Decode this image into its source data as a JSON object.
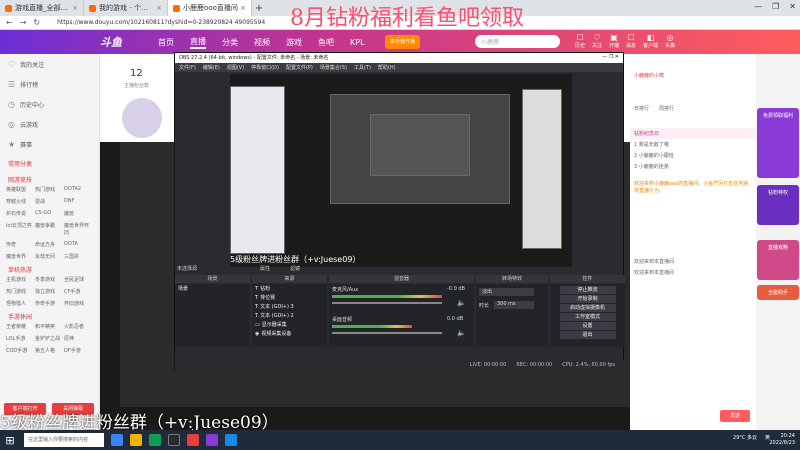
{
  "browser": {
    "tabs": [
      {
        "label": "游戏直播_全部游戏直播_斗鱼直...",
        "active": false
      },
      {
        "label": "我的游戏 - 个人中心 - 斗鱼",
        "active": false
      },
      {
        "label": "小鹿鹿ooo直播间",
        "active": true
      }
    ],
    "new_tab": "+",
    "url": "https://www.douyu.com/102160811?dyshid=0-238920824 49095594",
    "controls": [
      "—",
      "❐",
      "✕"
    ]
  },
  "site": {
    "logo": "斗鱼",
    "nav": [
      "首页",
      "直播",
      "分类",
      "视频",
      "游戏",
      "鱼吧",
      "KPL"
    ],
    "active_nav": "直播",
    "streamer_btn": "来听我开播",
    "search_placeholder": "小鹿鹿",
    "header_icons": [
      {
        "glyph": "☐",
        "label": "历史"
      },
      {
        "glyph": "♡",
        "label": "关注"
      },
      {
        "glyph": "▣",
        "label": "开播"
      },
      {
        "glyph": "☐",
        "label": "消息"
      },
      {
        "glyph": "◧",
        "label": "客户端"
      },
      {
        "glyph": "◎",
        "label": "头像"
      }
    ]
  },
  "sidebar": {
    "items": [
      {
        "icon": "♡",
        "label": "我的关注"
      },
      {
        "icon": "☰",
        "label": "排行榜"
      },
      {
        "icon": "◷",
        "label": "历史中心"
      },
      {
        "icon": "◎",
        "label": "云游戏"
      },
      {
        "icon": "★",
        "label": "赛事"
      }
    ],
    "sections": [
      {
        "title": "常用分类",
        "items": []
      },
      {
        "title": "网游竞技",
        "items": [
          "英雄联盟",
          "热门游戏",
          "DOTA2",
          "穿越火线",
          "逆战",
          "DNF",
          "炉石传说",
          "CS:GO",
          "魔兽",
          "lol云顶之弈",
          "魔兽争霸",
          "魔兽世界怀旧",
          "传奇",
          "命运方舟",
          "DOTA",
          "魔兽世界",
          "永劫无间",
          "三国杀"
        ]
      },
      {
        "title": "单机热游",
        "items": [
          "主机游戏",
          "冬季游戏",
          "全民足球",
          "热门游戏",
          "独立游戏",
          "CF手游",
          "怪物猎人",
          "传奇手游",
          "怀旧游戏"
        ]
      },
      {
        "title": "手游休闲",
        "items": [
          "王者荣耀",
          "和平精英",
          "火影忍者",
          "LOL手游",
          "金铲铲之战",
          "原神",
          "COD手游",
          "第五人格",
          "DF手游"
        ]
      }
    ],
    "buttons": [
      "客户端打开",
      "关闭弹幕"
    ]
  },
  "room": {
    "follow_count": "12",
    "follow_label": "主播粉丝数",
    "danmaku_top": "8月钻粉福利看鱼吧领取",
    "danmaku_bottom": "5级粉丝牌进粉丝群（+v:Juese09）"
  },
  "obs": {
    "title": "OBS 27.2.4 (64-bit, windows) - 配置文件: 未命名 - 场景: 未命名",
    "menu": [
      "文件(F)",
      "编辑(E)",
      "视图(V)",
      "停靠窗口(D)",
      "配置文件(P)",
      "场景集合(S)",
      "工具(T)",
      "帮助(H)"
    ],
    "preview_caption": "5级粉丝牌进粉丝群（+v:Juese09）",
    "scene_label": "场景",
    "sources_label": "来源",
    "mixer_label": "混音器",
    "transitions_label": "转场特效",
    "controls_label": "控件",
    "no_source": "未选择源",
    "properties": "属性",
    "filters": "滤镜",
    "scenes": [
      "场景"
    ],
    "sources": [
      "钻粉",
      "排位赛",
      "文本 (GDI+) 3",
      "文本 (GDI+) 2",
      "显示器采集",
      "视频采集设备"
    ],
    "mixer": [
      {
        "name": "麦克风/Aux",
        "db": "-0.0 dB"
      },
      {
        "name": "桌面音频",
        "db": "0.0 dB"
      }
    ],
    "transition": "淡出",
    "duration_label": "时长",
    "duration": "300 ms",
    "controls": [
      "停止推流",
      "开始录制",
      "启动虚拟摄像机",
      "工作室模式",
      "设置",
      "退出"
    ],
    "status": [
      "LIVE: 00:00:00",
      "REC: 00:00:00",
      "CPU: 2.4%, 60.00 fps"
    ]
  },
  "chat": {
    "header_user": "小鹿鹿的小窝",
    "tabs": [
      "日排行",
      "周排行"
    ],
    "rank_label": "钻粉纪念日",
    "fans": [
      {
        "rank": "1",
        "name": "我是无敌了哦"
      },
      {
        "rank": "2",
        "name": "小鹿鹿的小跟班"
      },
      {
        "rank": "3",
        "name": "小鹿鹿的迷弟"
      }
    ],
    "messages": [
      "欢迎来到小鹿鹿ooo的直播间，斗鱼严厉打击任何违规直播行为。",
      "欢迎来到本直播间",
      "欢迎来到本直播间"
    ],
    "send_label": "发送"
  },
  "promos": [
    "免费领取福利",
    "钻粉特权",
    "直播攻略",
    "全能助手"
  ],
  "taskbar": {
    "search_placeholder": "在这里输入你要搜索的内容",
    "weather": "29°C 多云",
    "lang": "英",
    "time": "20:24",
    "date": "2022/8/23"
  },
  "colors": {
    "brand": "#ff5d5d",
    "obs_bg": "#2a2b30",
    "danmaku": "#ff4d6d"
  }
}
